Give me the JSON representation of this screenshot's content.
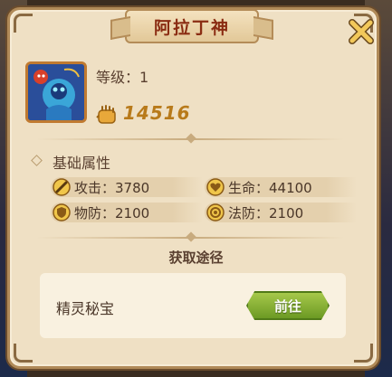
{
  "dialog": {
    "title": "阿拉丁神",
    "close_icon": "close-x-icon"
  },
  "hero": {
    "portrait_icon": "hero-portrait",
    "level_label": "等级：1",
    "power_icon": "fist-icon",
    "power_value": "14516"
  },
  "attributes": {
    "section_title": "基础属性",
    "stats": [
      {
        "icon": "sword-icon",
        "text": "攻击：3780"
      },
      {
        "icon": "heart-icon",
        "text": "生命：44100"
      },
      {
        "icon": "shield-icon",
        "text": "物防：2100"
      },
      {
        "icon": "magic-ring-icon",
        "text": "法防：2100"
      }
    ]
  },
  "acquire": {
    "section_title": "获取途径",
    "sources": [
      {
        "label": "精灵秘宝",
        "button_label": "前往"
      }
    ]
  },
  "colors": {
    "panel_bg": "#efe0c4",
    "title_text": "#8a2c12",
    "power_text": "#b87a1a",
    "go_button": "#8ab43a"
  }
}
